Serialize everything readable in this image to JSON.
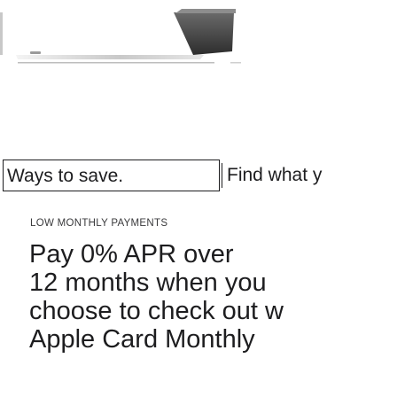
{
  "product_image": {
    "alt": ""
  },
  "tabs": [
    {
      "label": "Ways to save.",
      "active": true
    },
    {
      "label": "Find what y",
      "active": false
    }
  ],
  "eyebrow": "LOW MONTHLY PAYMENTS",
  "headline": {
    "lines": [
      "Pay 0% APR over",
      "12 months when you",
      "choose to check out w",
      "Apple Card Monthly"
    ]
  }
}
